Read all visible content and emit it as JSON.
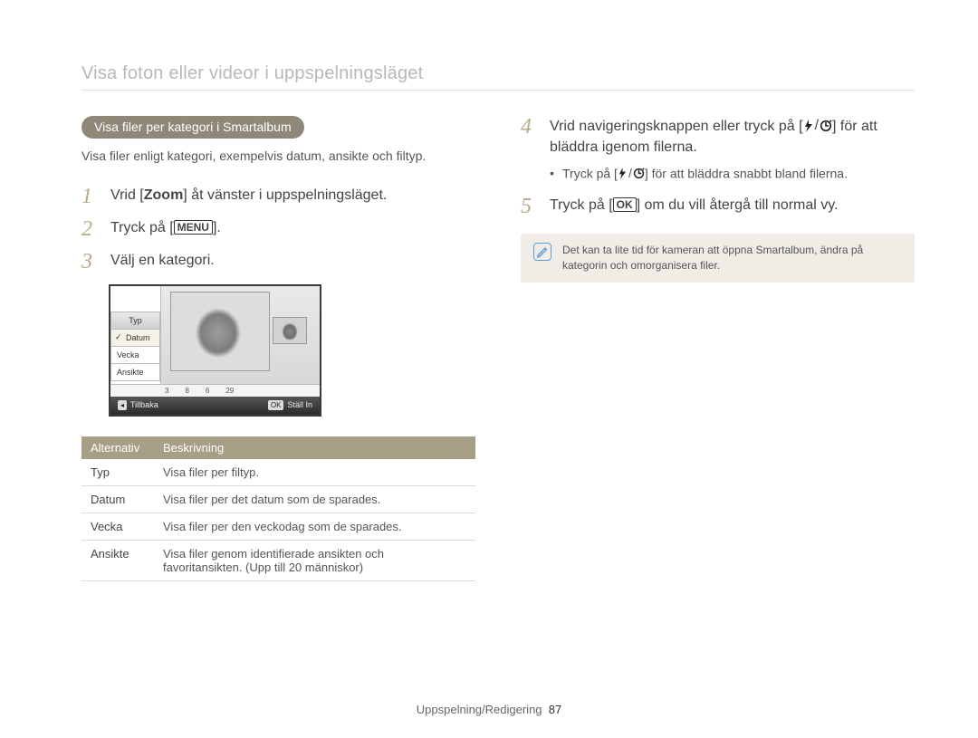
{
  "page_title": "Visa foton eller videor i uppspelningsläget",
  "left": {
    "section_pill": "Visa filer per kategori i Smartalbum",
    "intro": "Visa filer enligt kategori, exempelvis datum, ansikte och filtyp.",
    "steps": {
      "1_pre": "Vrid [",
      "1_bold": "Zoom",
      "1_post": "] åt vänster i uppspelningsläget.",
      "2_pre": "Tryck på [",
      "2_icon_label": "MENU",
      "2_post": "].",
      "3": "Välj en kategori."
    },
    "screenshot": {
      "menu_title": "Typ",
      "menu_items": [
        "Datum",
        "Vecka",
        "Ansikte"
      ],
      "ticks": [
        "3",
        "8",
        "6",
        "29"
      ],
      "bottom_left_key": "◂",
      "bottom_left_label": "Tillbaka",
      "bottom_right_key": "OK",
      "bottom_right_label": "Ställ In"
    },
    "table": {
      "head": [
        "Alternativ",
        "Beskrivning"
      ],
      "rows": [
        [
          "Typ",
          "Visa filer per filtyp."
        ],
        [
          "Datum",
          "Visa filer per det datum som de sparades."
        ],
        [
          "Vecka",
          "Visa filer per den veckodag som de sparades."
        ],
        [
          "Ansikte",
          "Visa filer genom identifierade ansikten och favoritansikten. (Upp till 20 människor)"
        ]
      ]
    }
  },
  "right": {
    "steps": {
      "4_pre": "Vrid navigeringsknappen eller tryck på [",
      "4_post": "] för att bläddra igenom filerna.",
      "4_sub_pre": "Tryck på [",
      "4_sub_post": "] för att bläddra snabbt bland filerna.",
      "5_pre": "Tryck på [",
      "5_icon_label": "OK",
      "5_post": "] om du vill återgå till normal vy."
    },
    "note": "Det kan ta lite tid för kameran att öppna Smartalbum, ändra på kategorin och omorganisera filer."
  },
  "footer": {
    "section": "Uppspelning/Redigering",
    "page_number": "87"
  }
}
